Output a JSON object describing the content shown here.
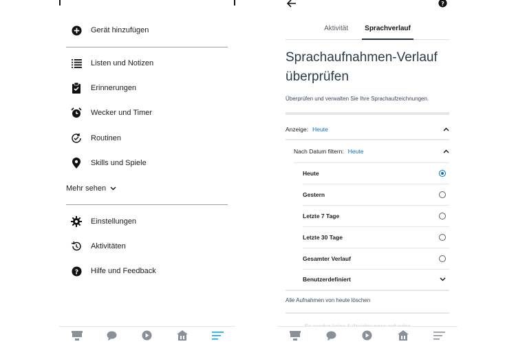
{
  "left_screen": {
    "menu": {
      "add_device": "Gerät hinzufügen",
      "lists": "Listen und Notizen",
      "reminders": "Erinnerungen",
      "alarms": "Wecker und Timer",
      "routines": "Routinen",
      "skills": "Skills und Spiele",
      "more": "Mehr sehen",
      "settings": "Einstellungen",
      "activities": "Aktivitäten",
      "help": "Hilfe und Feedback"
    },
    "bottom_nav": [
      "home-icon",
      "chat-icon",
      "play-icon",
      "devices-icon",
      "menu-icon"
    ],
    "active_nav_color": "#00a8e1"
  },
  "right_screen": {
    "tabs": [
      "Aktivität",
      "Sprachverlauf"
    ],
    "active_tab": 1,
    "title": "Sprachaufnahmen-Verlauf überprüfen",
    "subtitle": "Überprüfen und verwalten Sie Ihre Sprachaufzeichnungen.",
    "display_label": "Anzeige:",
    "display_value": "Heute",
    "filter_label": "Nach Datum filtern:",
    "filter_value": "Heute",
    "options": [
      "Heute",
      "Gestern",
      "Letzte 7 Tage",
      "Letzte 30 Tage",
      "Gesamter Verlauf"
    ],
    "custom_option": "Benutzerdefiniert",
    "delete_link": "Alle Aufnahmen von heute löschen",
    "empty_message": "Es wurden keine Aufzeichnungen gefunden",
    "accent_color": "#0073bb"
  }
}
